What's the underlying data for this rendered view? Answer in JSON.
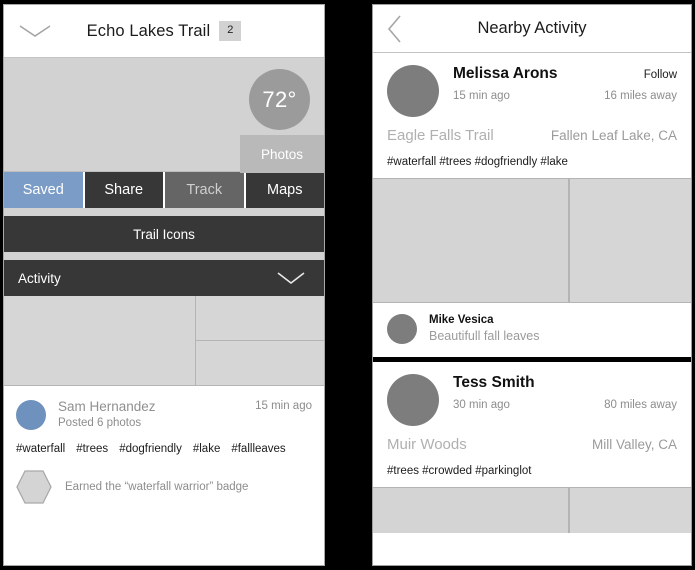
{
  "left_panel": {
    "header": {
      "back_icon": "chevron-down-icon",
      "title": "Echo Lakes Trail",
      "badge_count": "2"
    },
    "hero": {
      "temperature": "72°",
      "photos_label": "Photos"
    },
    "tabs": [
      {
        "label": "Saved",
        "state": "active"
      },
      {
        "label": "Share",
        "state": "default"
      },
      {
        "label": "Track",
        "state": "muted"
      },
      {
        "label": "Maps",
        "state": "default"
      }
    ],
    "trail_icons_label": "Trail Icons",
    "activity": {
      "label": "Activity",
      "chevron_icon": "chevron-down-icon"
    },
    "post": {
      "avatar_color": "#6f91bd",
      "name": "Sam Hernandez",
      "subtitle": "Posted 6 photos",
      "time": "15 min ago",
      "tags": [
        "#waterfall",
        "#trees",
        "#dogfriendly",
        "#lake",
        "#fallleaves"
      ],
      "badge_icon": "hexagon-badge-icon",
      "badge_text": "Earned the “waterfall warrior” badge"
    }
  },
  "right_panel": {
    "header": {
      "back_icon": "chevron-left-icon",
      "title": "Nearby Activity"
    },
    "cards": [
      {
        "name": "Melissa Arons",
        "follow_label": "Follow",
        "time": "15 min ago",
        "distance": "16 miles away",
        "trail": "Eagle Falls Trail",
        "location": "Fallen Leaf Lake, CA",
        "tags": "#waterfall #trees #dogfriendly #lake"
      },
      {
        "name": "Tess Smith",
        "follow_label": "",
        "time": "30 min ago",
        "distance": "80 miles away",
        "trail": "Muir Woods",
        "location": "Mill Valley, CA",
        "tags": "#trees #crowded #parkinglot"
      }
    ],
    "mini_post": {
      "name": "Mike Vesica",
      "caption": "Beautifull fall leaves"
    }
  },
  "colors": {
    "accent_blue": "#7a9cc6",
    "dark_bar": "#373737",
    "muted_tab": "#656565",
    "placeholder_gray": "#d2d2d2",
    "avatar_gray": "#7d7d7d"
  }
}
